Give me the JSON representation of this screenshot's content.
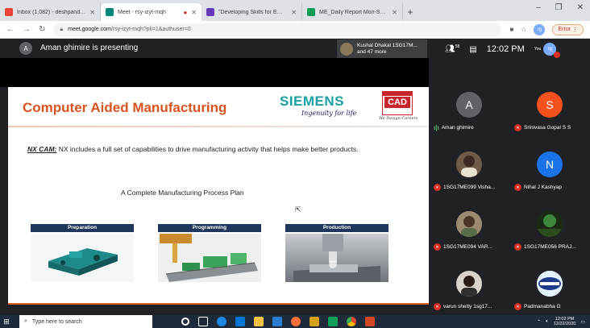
{
  "browser": {
    "tabs": [
      {
        "title": "Inbox (1,082) - deshpande@sapt",
        "favicon_color": "#ea4335"
      },
      {
        "title": "Meet - rsy-izyt-mqh",
        "favicon_color": "#00897b",
        "active": true
      },
      {
        "title": "\"Developing Skills for Employabi",
        "favicon_color": "#673ab7"
      },
      {
        "title": "ME_Daily Report Mon-Sat - Goo",
        "favicon_color": "#0f9d58"
      }
    ],
    "url_host": "meet.google.com",
    "url_path": "/rsy-izyt-mqh?pli=1&authuser=0",
    "error_label": "Error",
    "profile_initials": "rg"
  },
  "meet": {
    "presenter_initial": "A",
    "presenting_text": "Aman ghimire is presenting",
    "pinned_line1": "Kushal Dhakal 1SG17M...",
    "pinned_line2": "and 47 more",
    "people_count": "58",
    "clock": "12:02 PM",
    "you_label": "You",
    "you_initials": "rg"
  },
  "slide": {
    "title": "Computer Aided Manufacturing",
    "brand": "SIEMENS",
    "tagline": "Ingenuity for life",
    "cad_logo": "CAD",
    "cad_signature": "We Design Careers",
    "desc_prefix": "NX CAM:",
    "desc_text": " NX includes a full set of capabilities to drive manufacturing activity that helps make better products.",
    "subtitle": "A Complete Manufacturing Process Plan",
    "steps": [
      {
        "label": "Preparation"
      },
      {
        "label": "Programming"
      },
      {
        "label": "Production"
      }
    ]
  },
  "participants": [
    {
      "name": "Aman ghimire",
      "initial": "A",
      "color": "#5f6368",
      "speaking": true
    },
    {
      "name": "Srinivasa Gopal S S",
      "initial": "S",
      "color": "#f4511e",
      "muted": true
    },
    {
      "name": "1SG17ME099 Visha...",
      "initial": "",
      "color": "#6d5a48",
      "muted": true
    },
    {
      "name": "Nihal J Kashyap",
      "initial": "N",
      "color": "#1a73e8",
      "muted": true
    },
    {
      "name": "1SG17ME094 VAR...",
      "initial": "",
      "color": "#8d6e63",
      "muted": true
    },
    {
      "name": "1SG17ME056 PRAJ...",
      "initial": "",
      "color": "#33691e",
      "muted": true
    },
    {
      "name": "varun shetty 1sg17...",
      "initial": "",
      "color": "#4e4038",
      "muted": true
    },
    {
      "name": "Padmanabha G",
      "initial": "",
      "color": "#e3f2fd",
      "muted": true
    }
  ],
  "taskbar": {
    "search_placeholder": "Type here to search",
    "time": "12:02 PM",
    "date": "12/22/2020"
  }
}
